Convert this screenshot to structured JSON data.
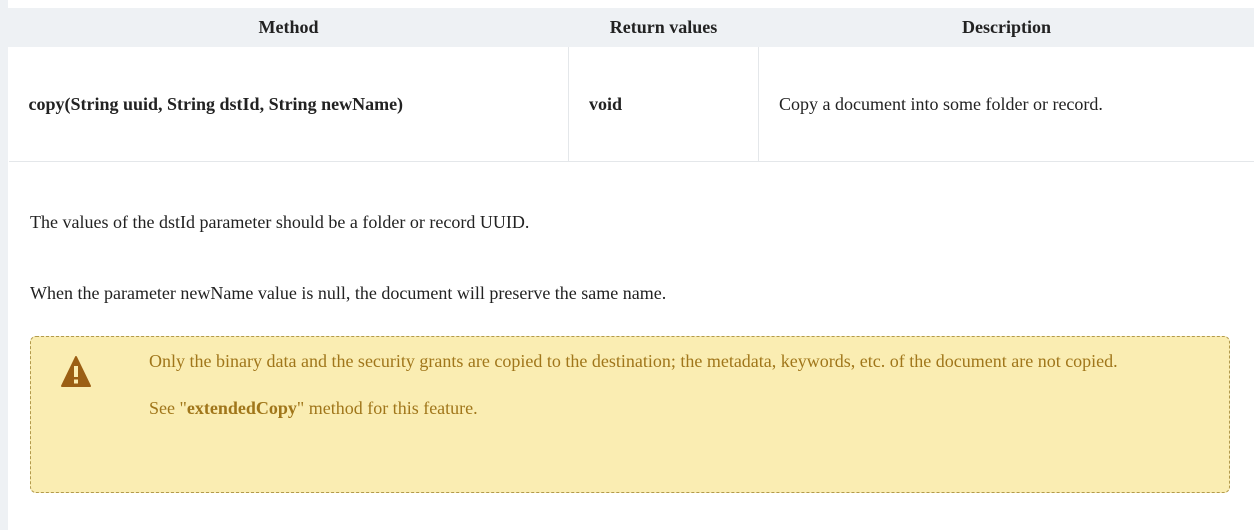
{
  "table": {
    "headers": [
      "Method",
      "Return values",
      "Description"
    ],
    "row": {
      "method": "copy(String uuid, String dstId, String newName)",
      "return_value": "void",
      "description": "Copy a document into some folder or record."
    }
  },
  "paragraphs": [
    "The values of the dstId parameter should be a folder or record UUID.",
    "When the parameter newName value is null, the document will preserve the same name."
  ],
  "warning": {
    "icon": "warning-triangle-icon",
    "text": "Only the binary data and the security grants are copied to the destination; the metadata, keywords, etc. of the document are not copied.",
    "see_prefix": "See \"",
    "see_link": "extendedCopy",
    "see_suffix": "\" method for this feature.",
    "color_background": "#faedb2",
    "color_text": "#a0761a",
    "color_icon": "#9b5f14"
  }
}
